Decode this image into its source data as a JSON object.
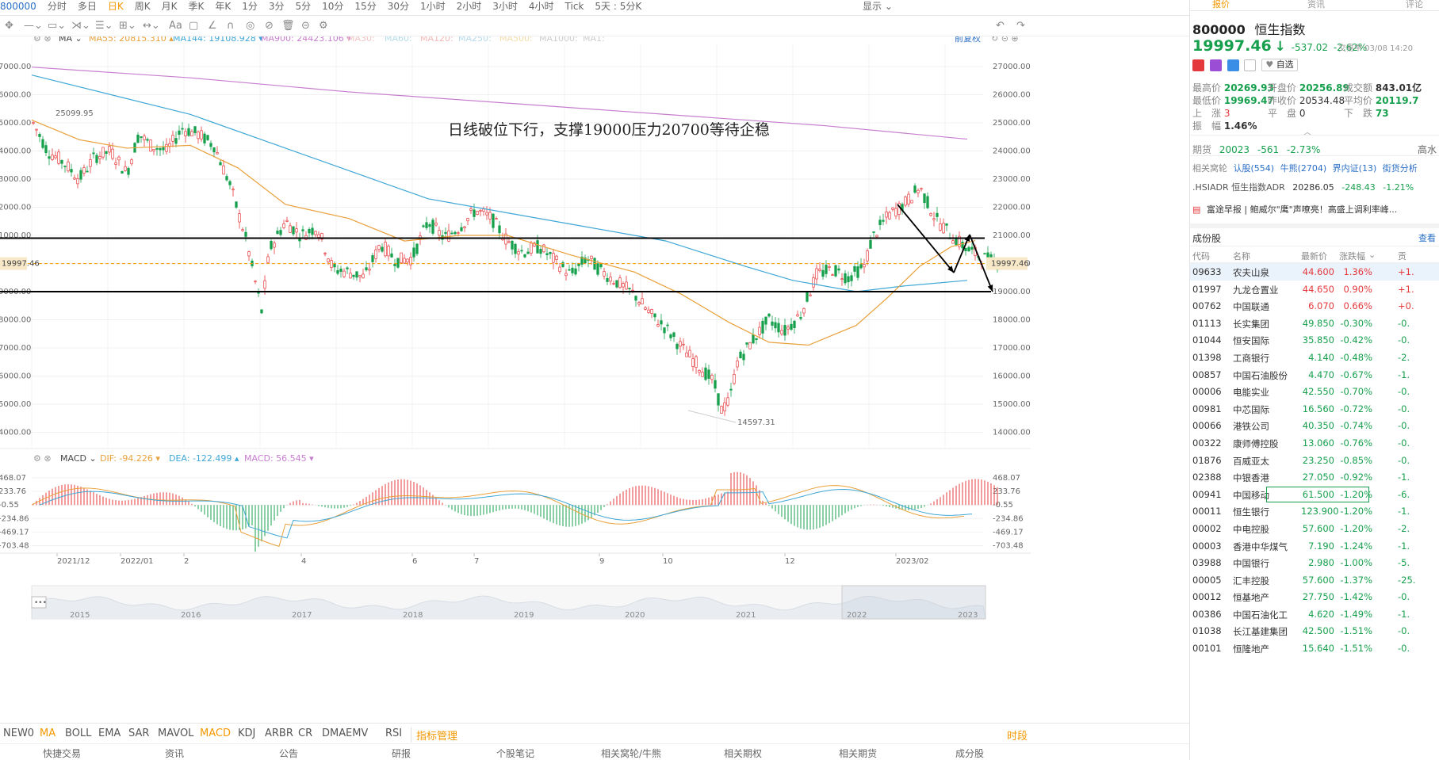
{
  "timeframes": [
    "800000",
    "分时",
    "多日",
    "日K",
    "周K",
    "月K",
    "季K",
    "年K",
    "1分",
    "3分",
    "5分",
    "10分",
    "15分",
    "30分",
    "1小时",
    "2小时",
    "3小时",
    "4小时",
    "Tick",
    "5天 : 5分K"
  ],
  "active_timeframe_index": 3,
  "topbar_right": {
    "display": "显示"
  },
  "ma_legend": {
    "label": "MA",
    "ma55": "MA55: 20815.310",
    "ma144": "MA144: 19108.928",
    "ma900": "MA900: 24423.106",
    "ma30": "MA30:",
    "ma60": "MA60:",
    "ma120": "MA120:",
    "ma250": "MA250:",
    "ma500": "MA500:",
    "ma1000": "MA1000:",
    "ma1": "MA1:",
    "adjust": "前复权"
  },
  "colors": {
    "up": "#e4393c",
    "down": "#16a04d",
    "ma55": "#e8a03a",
    "ma144": "#3fa7d6",
    "ma900": "#c77dce"
  },
  "annotation": "日线破位下行，支撑19000压力20700等待企稳",
  "price_axis": [
    "27000.00",
    "26000.00",
    "25000.00",
    "24000.00",
    "23000.00",
    "22000.00",
    "21000.00",
    "20000.00",
    "19000.00",
    "18000.00",
    "17000.00",
    "16000.00",
    "15000.00",
    "14000.00"
  ],
  "left_axis": [
    "7000.00",
    "6000.00",
    "5000.00",
    "4000.00",
    "3000.00",
    "2000.00",
    "1000.00",
    "19997.46",
    "9000.00",
    "8000.00",
    "7000.00",
    "6000.00",
    "5000.00",
    "4000.00"
  ],
  "current_price_tag": "19997.46",
  "high_label": "25099.95",
  "low_label": "14597.31",
  "macd_legend": {
    "label": "MACD",
    "dif": "DIF: -94.226",
    "dea": "DEA: -122.499",
    "macd": "MACD: 56.545"
  },
  "macd_axis": [
    "468.07",
    "233.76",
    "-0.55",
    "-234.86",
    "-469.17",
    "-703.48"
  ],
  "time_axis": [
    "2021/12",
    "2022/01",
    "2",
    "4",
    "6",
    "7",
    "9",
    "10",
    "12",
    "2023/02"
  ],
  "overview_years": [
    "2015",
    "2016",
    "2017",
    "2018",
    "2019",
    "2020",
    "2021",
    "2022",
    "2023"
  ],
  "indicator_tabs": [
    "NEW0",
    "MA",
    "BOLL",
    "EMA",
    "SAR",
    "MAVOL",
    "MACD",
    "KDJ",
    "ARBR",
    "CR",
    "DMA",
    "EMV",
    "RSI",
    "指标管理"
  ],
  "indicator_right": "时段",
  "bottom_tabs": [
    "快捷交易",
    "资讯",
    "公告",
    "研报",
    "个股笔记",
    "相关窝轮/牛熊",
    "相关期权",
    "相关期货",
    "成分股"
  ],
  "right_tabs": [
    "报价",
    "资讯",
    "评论"
  ],
  "quote": {
    "code": "800000",
    "name": "恒生指数",
    "price": "19997.46",
    "arrow": "↓",
    "change": "-537.02",
    "pct": "-2.62%",
    "time": "交易中 03/08 14:20",
    "watch": "自选",
    "high_l": "最高价",
    "high": "20269.93",
    "open_l": "开盘价",
    "open": "20256.89",
    "amt_l": "成交额",
    "amt": "843.01亿",
    "low_l": "最低价",
    "low": "19969.47",
    "prev_l": "昨收价",
    "prev": "20534.48",
    "avg_l": "平均价",
    "avg": "20119.7",
    "up_l": "上　涨",
    "up": "3",
    "flat_l": "平　盘",
    "flat": "0",
    "down_l": "下　跌",
    "down": "73",
    "amp_l": "振　幅",
    "amp": "1.46%",
    "fut_l": "期货",
    "fut": "20023",
    "fut_chg": "-561",
    "fut_pct": "-2.73%",
    "fut_right": "高水",
    "rel_l": "相关窝轮",
    "rel1": "认股(554)",
    "rel2": "牛熊(2704)",
    "rel3": "界内证(13)",
    "rel4": "街货分析",
    "adr_name": ".HSIADR 恒生指数ADR",
    "adr_val": "20286.05",
    "adr_chg": "-248.43",
    "adr_pct": "-1.21%",
    "news": "富途早报 | 鲍威尔\"鹰\"声嘹亮！高盛上调利率峰..."
  },
  "constituents": {
    "title": "成份股",
    "more": "查看",
    "headers": [
      "代码",
      "名称",
      "最新价",
      "涨跌幅",
      "贡"
    ],
    "rows": [
      [
        "09633",
        "农夫山泉",
        "44.600",
        "1.36%",
        "+1."
      ],
      [
        "01997",
        "九龙仓置业",
        "44.650",
        "0.90%",
        "+1."
      ],
      [
        "00762",
        "中国联通",
        "6.070",
        "0.66%",
        "+0."
      ],
      [
        "01113",
        "长实集团",
        "49.850",
        "-0.30%",
        "-0."
      ],
      [
        "01044",
        "恒安国际",
        "35.850",
        "-0.42%",
        "-0."
      ],
      [
        "01398",
        "工商银行",
        "4.140",
        "-0.48%",
        "-2."
      ],
      [
        "00857",
        "中国石油股份",
        "4.470",
        "-0.67%",
        "-1."
      ],
      [
        "00006",
        "电能实业",
        "42.550",
        "-0.70%",
        "-0."
      ],
      [
        "00981",
        "中芯国际",
        "16.560",
        "-0.72%",
        "-0."
      ],
      [
        "00066",
        "港铁公司",
        "40.350",
        "-0.74%",
        "-0."
      ],
      [
        "00322",
        "康师傅控股",
        "13.060",
        "-0.76%",
        "-0."
      ],
      [
        "01876",
        "百威亚太",
        "23.250",
        "-0.85%",
        "-0."
      ],
      [
        "02388",
        "中银香港",
        "27.050",
        "-0.92%",
        "-1."
      ],
      [
        "00941",
        "中国移动",
        "61.500",
        "-1.20%",
        "-6."
      ],
      [
        "00011",
        "恒生银行",
        "123.900",
        "-1.20%",
        "-1."
      ],
      [
        "00002",
        "中电控股",
        "57.600",
        "-1.20%",
        "-2."
      ],
      [
        "00003",
        "香港中华煤气",
        "7.190",
        "-1.24%",
        "-1."
      ],
      [
        "03988",
        "中国银行",
        "2.980",
        "-1.00%",
        "-5."
      ],
      [
        "00005",
        "汇丰控股",
        "57.600",
        "-1.37%",
        "-25."
      ],
      [
        "00012",
        "恒基地产",
        "27.750",
        "-1.42%",
        "-0."
      ],
      [
        "00386",
        "中国石油化工",
        "4.620",
        "-1.49%",
        "-1."
      ],
      [
        "01038",
        "长江基建集团",
        "42.500",
        "-1.51%",
        "-0."
      ],
      [
        "00101",
        "恒隆地产",
        "15.640",
        "-1.51%",
        "-0."
      ]
    ]
  }
}
